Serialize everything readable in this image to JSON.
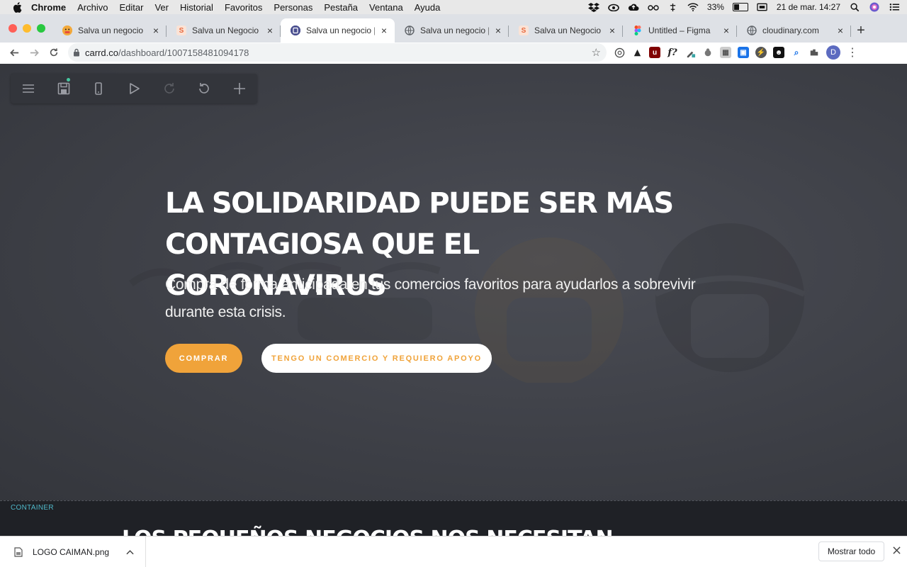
{
  "menubar": {
    "items": [
      "Chrome",
      "Archivo",
      "Editar",
      "Ver",
      "Historial",
      "Favoritos",
      "Personas",
      "Pestaña",
      "Ventana",
      "Ayuda"
    ],
    "battery": "33%",
    "datetime": "21 de mar. 14:27"
  },
  "tabs": [
    {
      "title": "Salva un negocio",
      "favicon": "smiley-icon",
      "color": "#f2a93b"
    },
    {
      "title": "Salva un Negocio · N",
      "favicon": "sketch-s-icon",
      "color": "#e8693d"
    },
    {
      "title": "Salva un negocio | C",
      "favicon": "carrd-icon",
      "color": "#4a4f8f"
    },
    {
      "title": "Salva un negocio | C",
      "favicon": "globe-icon",
      "color": "#5f6368"
    },
    {
      "title": "Salva un Negocio · N",
      "favicon": "sketch-s-icon",
      "color": "#e8693d"
    },
    {
      "title": "Untitled – Figma",
      "favicon": "figma-icon",
      "color": "#a259ff"
    },
    {
      "title": "cloudinary.com",
      "favicon": "globe-icon",
      "color": "#5f6368"
    }
  ],
  "address": {
    "host": "carrd.co",
    "path": "/dashboard/1007158481094178"
  },
  "profile_initial": "D",
  "hero": {
    "headline_line1": "LA SOLIDARIDAD PUEDE SER MÁS",
    "headline_line2": "CONTAGIOSA QUE EL CORONAVIRUS",
    "subtext": "Compra de forma anticipada en tus comercios favoritos para ayudarlos a sobrevivir durante esta crisis.",
    "primary_button": "COMPRAR",
    "secondary_button": "TENGO UN COMERCIO Y REQUIERO APOYO"
  },
  "container": {
    "label": "CONTAINER",
    "heading": "LOS PEQUEÑOS NEGOCIOS NOS NECESITAN"
  },
  "downloads": {
    "file_name": "LOGO CAIMAN.png",
    "show_all": "Mostrar todo"
  },
  "colors": {
    "accent": "#f0a33a",
    "hero_bg": "#3e4047",
    "container_label": "#4fb8c9"
  }
}
